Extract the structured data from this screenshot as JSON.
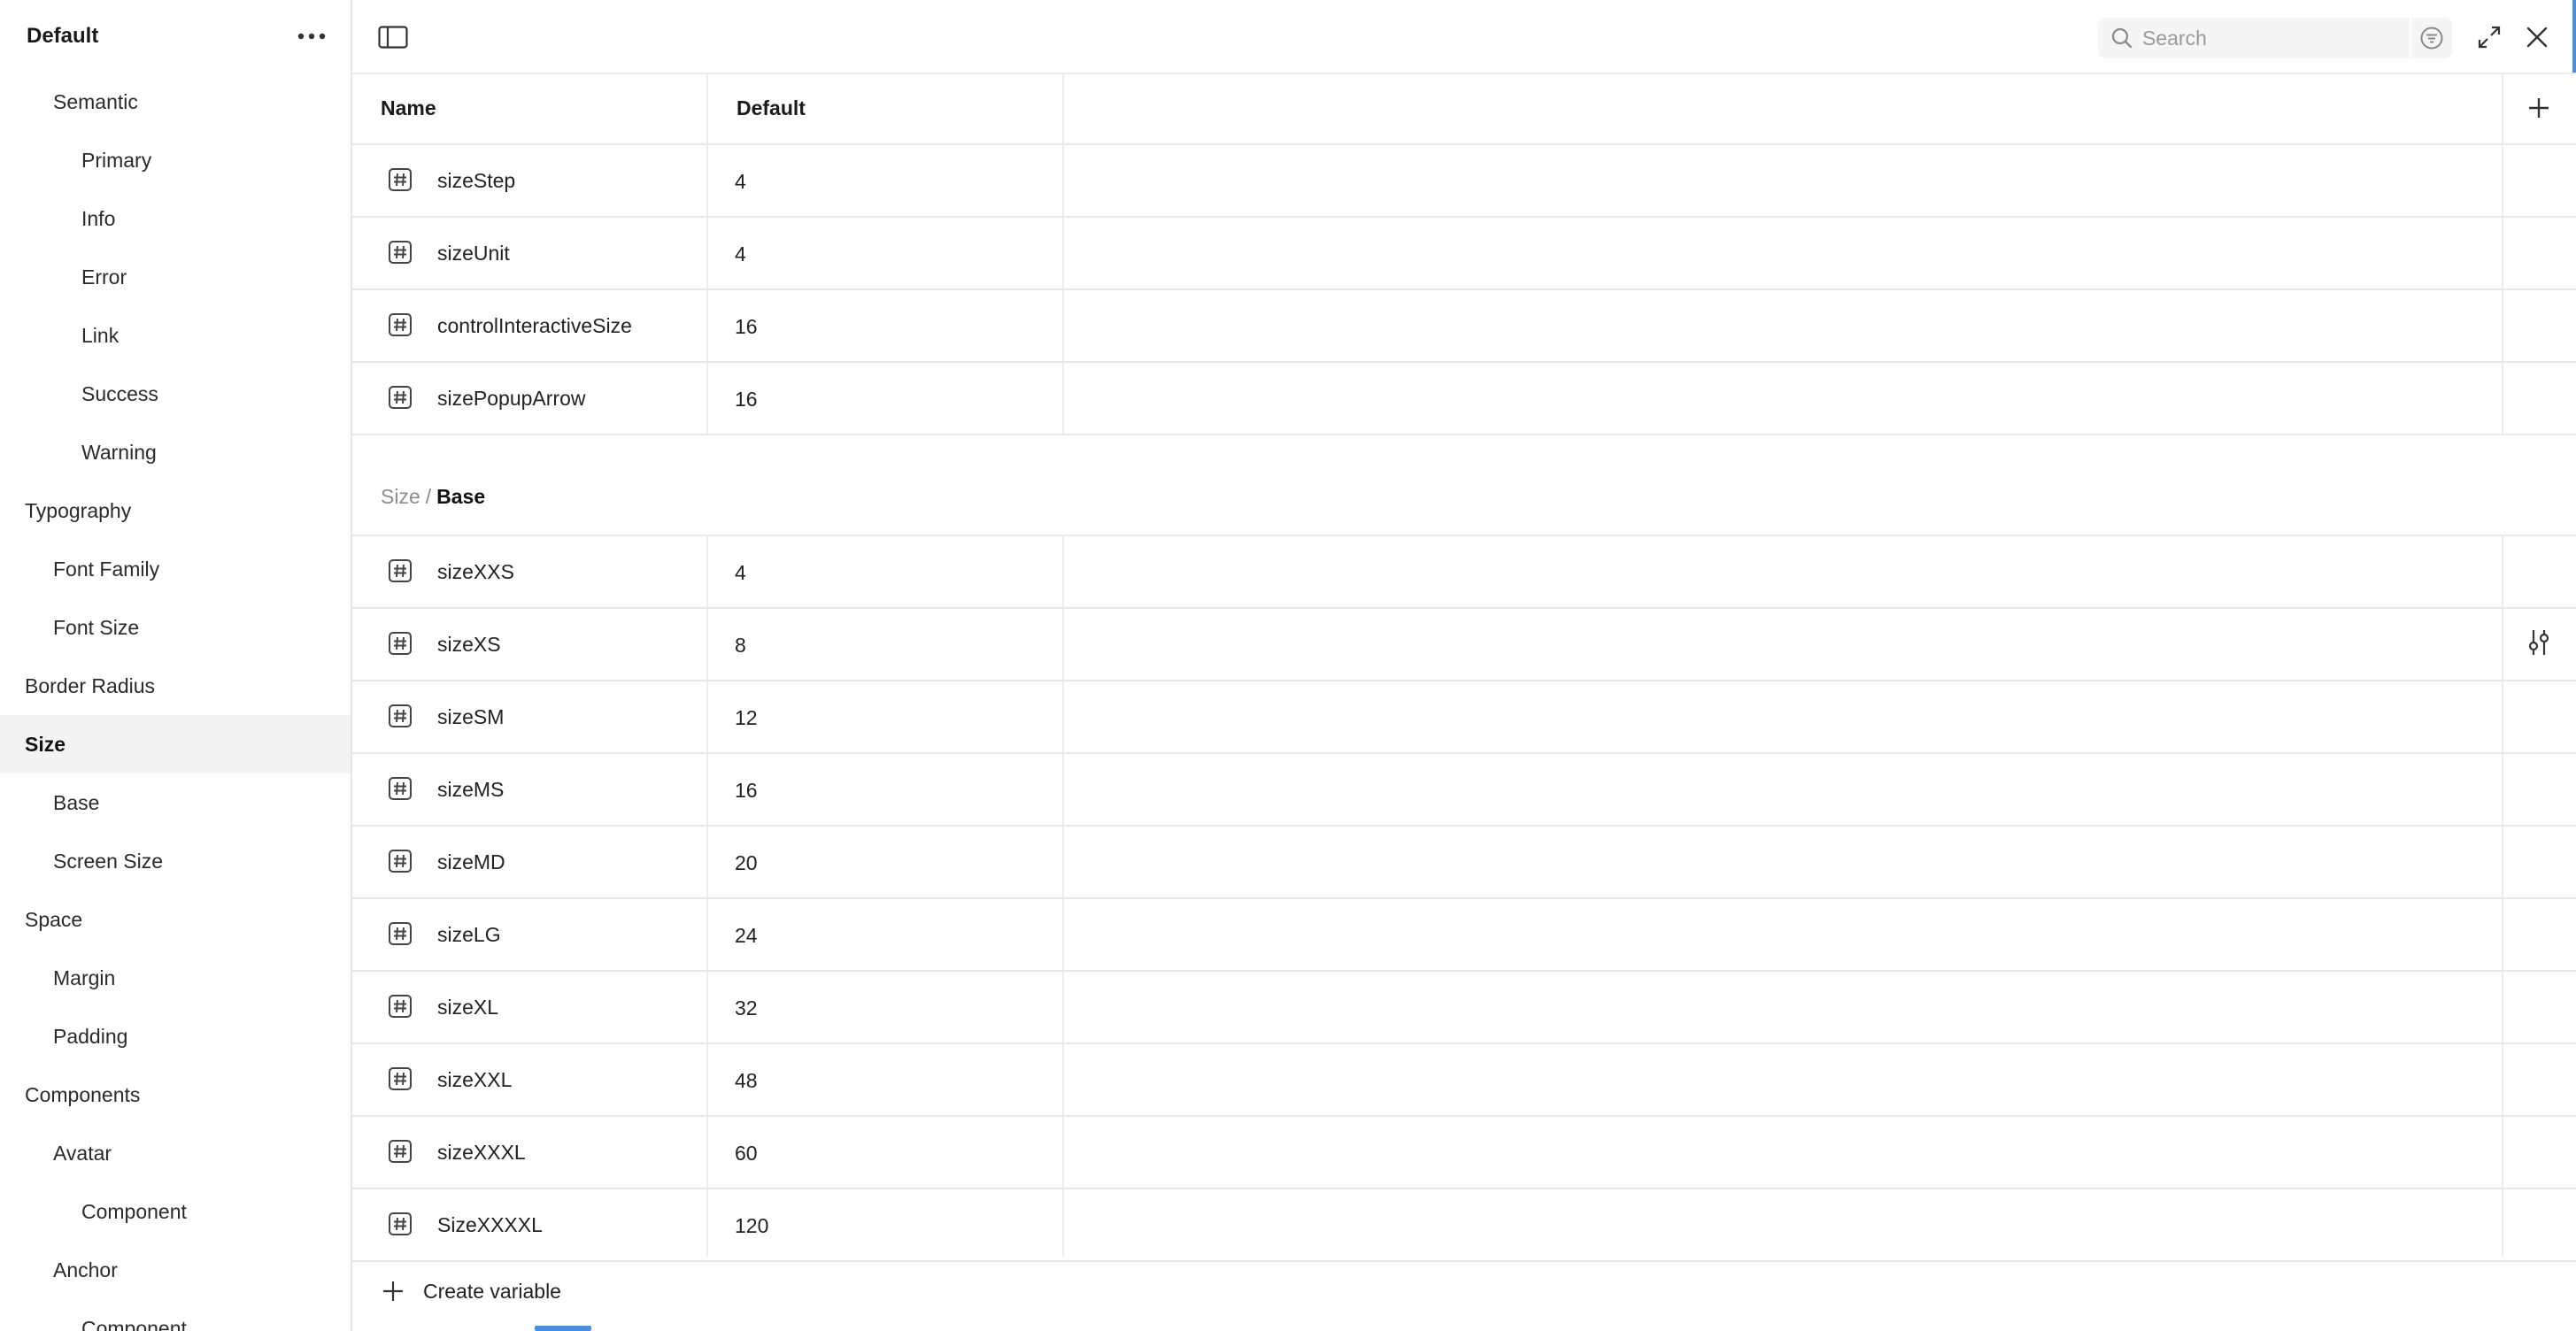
{
  "sidebar": {
    "title": "Default",
    "items": [
      {
        "label": "Semantic",
        "level": 1
      },
      {
        "label": "Primary",
        "level": 2
      },
      {
        "label": "Info",
        "level": 2
      },
      {
        "label": "Error",
        "level": 2
      },
      {
        "label": "Link",
        "level": 2
      },
      {
        "label": "Success",
        "level": 2
      },
      {
        "label": "Warning",
        "level": 2
      },
      {
        "label": "Typography",
        "level": 0
      },
      {
        "label": "Font Family",
        "level": 1
      },
      {
        "label": "Font Size",
        "level": 1
      },
      {
        "label": "Border Radius",
        "level": 0
      },
      {
        "label": "Size",
        "level": 0,
        "active": true
      },
      {
        "label": "Base",
        "level": 1
      },
      {
        "label": "Screen Size",
        "level": 1
      },
      {
        "label": "Space",
        "level": 0
      },
      {
        "label": "Margin",
        "level": 1
      },
      {
        "label": "Padding",
        "level": 1
      },
      {
        "label": "Components",
        "level": 0
      },
      {
        "label": "Avatar",
        "level": 1
      },
      {
        "label": "Component",
        "level": 2
      },
      {
        "label": "Anchor",
        "level": 1
      },
      {
        "label": "Component",
        "level": 2
      }
    ]
  },
  "search": {
    "placeholder": "Search",
    "value": ""
  },
  "table": {
    "columns": {
      "name": "Name",
      "mode": "Default"
    },
    "group1_rows": [
      {
        "name": "sizeStep",
        "value": "4"
      },
      {
        "name": "sizeUnit",
        "value": "4"
      },
      {
        "name": "controlInteractiveSize",
        "value": "16"
      },
      {
        "name": "sizePopupArrow",
        "value": "16"
      }
    ],
    "group2": {
      "parent": "Size",
      "separator": "/",
      "current": "Base"
    },
    "group2_rows": [
      {
        "name": "sizeXXS",
        "value": "4"
      },
      {
        "name": "sizeXS",
        "value": "8",
        "hovered": true
      },
      {
        "name": "sizeSM",
        "value": "12"
      },
      {
        "name": "sizeMS",
        "value": "16"
      },
      {
        "name": "sizeMD",
        "value": "20"
      },
      {
        "name": "sizeLG",
        "value": "24"
      },
      {
        "name": "sizeXL",
        "value": "32"
      },
      {
        "name": "sizeXXL",
        "value": "48"
      },
      {
        "name": "sizeXXXL",
        "value": "60"
      },
      {
        "name": "SizeXXXXL",
        "value": "120"
      }
    ]
  },
  "footer": {
    "create_label": "Create variable"
  },
  "icons": {
    "more": "more-horizontal-icon",
    "panel": "sidebar-toggle-icon",
    "search": "search-icon",
    "filter": "filter-icon",
    "expand": "expand-icon",
    "close": "close-icon",
    "add": "plus-icon",
    "variable": "number-variable-icon",
    "edit": "adjust-sliders-icon"
  },
  "colors": {
    "accent": "#4a90e2",
    "active_bg": "#f3f3f3",
    "border": "#e8e8e8"
  }
}
